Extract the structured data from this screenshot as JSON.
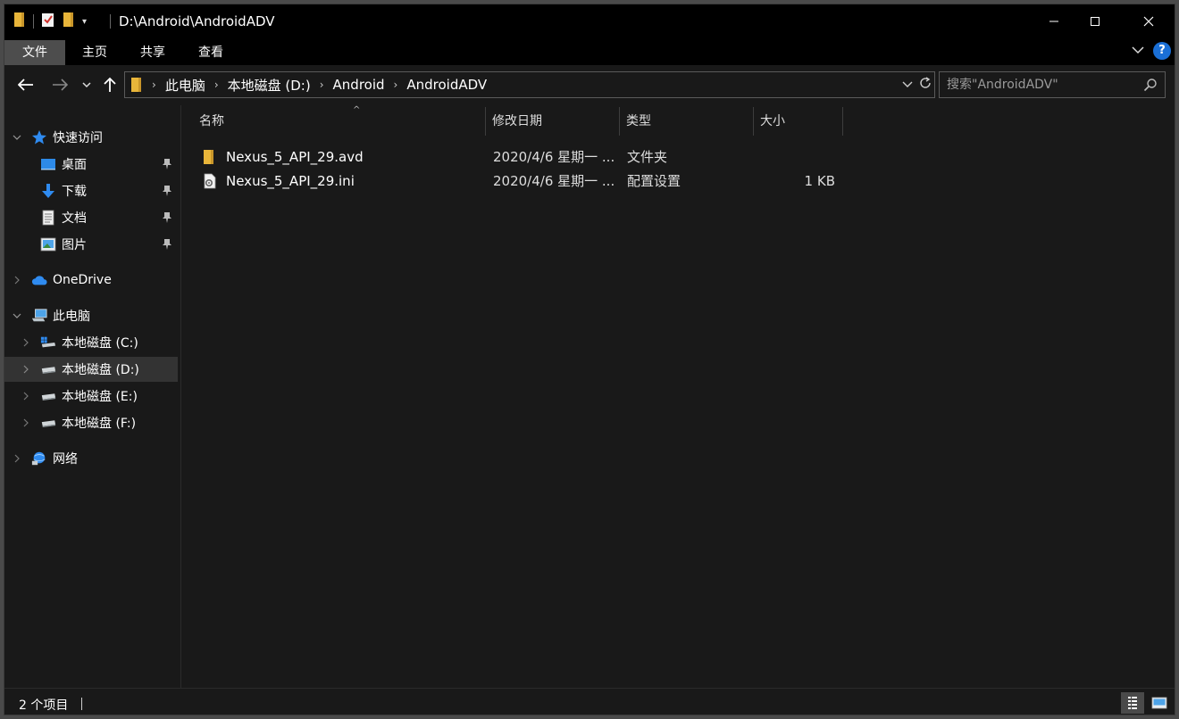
{
  "window": {
    "title": "D:\\Android\\AndroidADV",
    "colors": {
      "background": "#191919",
      "titlebar": "#000000",
      "accent": "#1a6fd6",
      "folder": "#e8b53a"
    }
  },
  "ribbon": {
    "tabs": [
      {
        "label": "文件",
        "active": true
      },
      {
        "label": "主页",
        "active": false
      },
      {
        "label": "共享",
        "active": false
      },
      {
        "label": "查看",
        "active": false
      }
    ],
    "help_label": "?"
  },
  "navbar": {
    "breadcrumbs": [
      "此电脑",
      "本地磁盘 (D:)",
      "Android",
      "AndroidADV"
    ],
    "search_placeholder": "搜索\"AndroidADV\""
  },
  "sidebar": {
    "quick_access": {
      "label": "快速访问",
      "icon": "star-icon"
    },
    "quick_items": [
      {
        "label": "桌面",
        "icon": "desktop-icon",
        "pinned": true
      },
      {
        "label": "下载",
        "icon": "download-icon",
        "pinned": true
      },
      {
        "label": "文档",
        "icon": "document-icon",
        "pinned": true
      },
      {
        "label": "图片",
        "icon": "pictures-icon",
        "pinned": true
      }
    ],
    "onedrive": {
      "label": "OneDrive",
      "icon": "cloud-icon"
    },
    "this_pc": {
      "label": "此电脑",
      "icon": "computer-icon"
    },
    "drives": [
      {
        "label": "本地磁盘 (C:)",
        "icon": "system-drive-icon",
        "selected": false
      },
      {
        "label": "本地磁盘 (D:)",
        "icon": "drive-icon",
        "selected": true
      },
      {
        "label": "本地磁盘 (E:)",
        "icon": "drive-icon",
        "selected": false
      },
      {
        "label": "本地磁盘 (F:)",
        "icon": "drive-icon",
        "selected": false
      }
    ],
    "network": {
      "label": "网络",
      "icon": "network-icon"
    }
  },
  "file_list": {
    "columns": [
      "名称",
      "修改日期",
      "类型",
      "大小"
    ],
    "sort_column": "名称",
    "rows": [
      {
        "name": "Nexus_5_API_29.avd",
        "date": "2020/4/6 星期一 ...",
        "type": "文件夹",
        "size": "",
        "icon": "folder-icon"
      },
      {
        "name": "Nexus_5_API_29.ini",
        "date": "2020/4/6 星期一 ...",
        "type": "配置设置",
        "size": "1 KB",
        "icon": "config-file-icon"
      }
    ]
  },
  "statusbar": {
    "item_count": "2 个项目",
    "view_mode": "details"
  }
}
